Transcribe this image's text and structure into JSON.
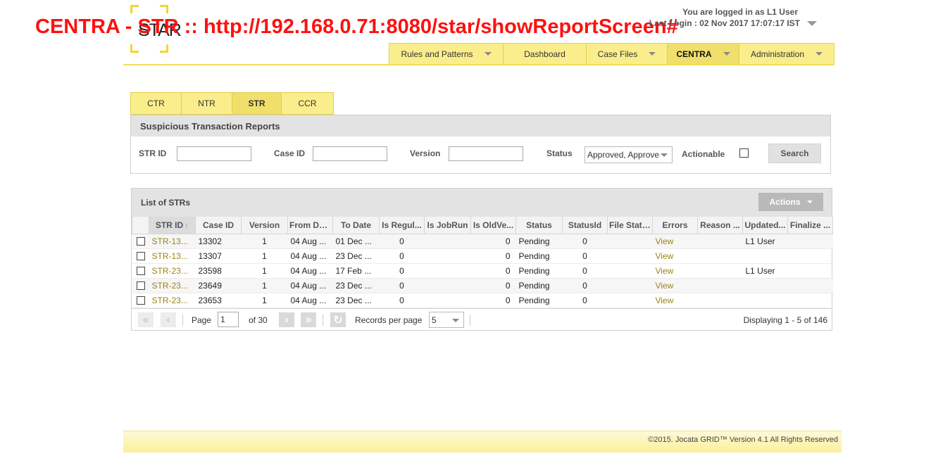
{
  "overlay_title": "CENTRA - STR :: http://192.168.0.71:8080/star/showReportScreen#",
  "logo": {
    "text": "STAR"
  },
  "login": {
    "user_text": "You are logged in as L1 User",
    "last_login": "Last Login : 02 Nov 2017 17:07:17 IST"
  },
  "nav": [
    {
      "label": "Rules and Patterns",
      "dropdown": true
    },
    {
      "label": "Dashboard",
      "dropdown": false
    },
    {
      "label": "Case Files",
      "dropdown": true
    },
    {
      "label": "CENTRA",
      "dropdown": true,
      "active": true
    },
    {
      "label": "Administration",
      "dropdown": true
    }
  ],
  "sub_tabs": [
    {
      "label": "CTR"
    },
    {
      "label": "NTR"
    },
    {
      "label": "STR",
      "active": true
    },
    {
      "label": "CCR"
    }
  ],
  "search": {
    "title": "Suspicious Transaction Reports",
    "str_id_label": "STR ID",
    "str_id_value": "",
    "case_id_label": "Case ID",
    "case_id_value": "",
    "version_label": "Version",
    "version_value": "",
    "status_label": "Status",
    "status_value": "Approved, Approve",
    "actionable_label": "Actionable",
    "actionable_checked": false,
    "search_button": "Search"
  },
  "grid": {
    "title": "List of STRs",
    "actions_label": "Actions",
    "columns": [
      "",
      "STR ID",
      "Case ID",
      "Version",
      "From Date",
      "To Date",
      "Is Regul...",
      "Is JobRun",
      "Is OldVe...",
      "Status",
      "StatusId",
      "File Status",
      "Errors",
      "Reason ...",
      "Updated...",
      "Finalize ..."
    ],
    "rows": [
      {
        "str_id": "STR-13...",
        "case_id": "13302",
        "version": "1",
        "from": "04 Aug ...",
        "to": "01 Dec ...",
        "is_regul": "0",
        "is_jobrun": "",
        "is_oldve": "0",
        "status": "Pending",
        "status_id": "0",
        "file_status": "",
        "errors": "View",
        "reason": "",
        "updated": "L1 User",
        "finalize": ""
      },
      {
        "str_id": "STR-13...",
        "case_id": "13307",
        "version": "1",
        "from": "04 Aug ...",
        "to": "23 Dec ...",
        "is_regul": "0",
        "is_jobrun": "",
        "is_oldve": "0",
        "status": "Pending",
        "status_id": "0",
        "file_status": "",
        "errors": "View",
        "reason": "",
        "updated": "",
        "finalize": ""
      },
      {
        "str_id": "STR-23...",
        "case_id": "23598",
        "version": "1",
        "from": "04 Aug ...",
        "to": "17 Feb ...",
        "is_regul": "0",
        "is_jobrun": "",
        "is_oldve": "0",
        "status": "Pending",
        "status_id": "0",
        "file_status": "",
        "errors": "View",
        "reason": "",
        "updated": "L1 User",
        "finalize": ""
      },
      {
        "str_id": "STR-23...",
        "case_id": "23649",
        "version": "1",
        "from": "04 Aug ...",
        "to": "23 Dec ...",
        "is_regul": "0",
        "is_jobrun": "",
        "is_oldve": "0",
        "status": "Pending",
        "status_id": "0",
        "file_status": "",
        "errors": "View",
        "reason": "",
        "updated": "",
        "finalize": ""
      },
      {
        "str_id": "STR-23...",
        "case_id": "23653",
        "version": "1",
        "from": "04 Aug ...",
        "to": "23 Dec ...",
        "is_regul": "0",
        "is_jobrun": "",
        "is_oldve": "0",
        "status": "Pending",
        "status_id": "0",
        "file_status": "",
        "errors": "View",
        "reason": "",
        "updated": "",
        "finalize": ""
      }
    ]
  },
  "pager": {
    "page_label": "Page",
    "page_value": "1",
    "of_label": "of 30",
    "rpp_label": "Records per page",
    "rpp_value": "5",
    "displaying": "Displaying 1 - 5 of 146",
    "first_icon": "«",
    "prev_icon": "‹",
    "next_icon": "›",
    "last_icon": "»",
    "refresh_icon": "↻"
  },
  "footer": {
    "text": "©2015. Jocata GRID™ Version 4.1 All Rights Reserved"
  },
  "colors": {
    "accent_yellow": "#faee8c",
    "active_tab": "#f0df6a",
    "link": "#9b8416",
    "overlay_red": "#ff1010"
  }
}
